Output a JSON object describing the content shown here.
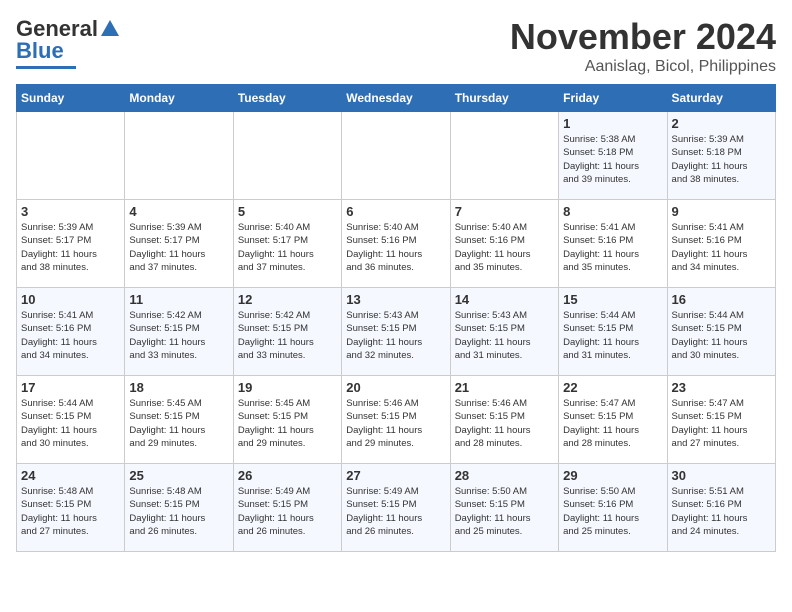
{
  "header": {
    "logo_general": "General",
    "logo_blue": "Blue",
    "month": "November 2024",
    "location": "Aanislag, Bicol, Philippines"
  },
  "days_of_week": [
    "Sunday",
    "Monday",
    "Tuesday",
    "Wednesday",
    "Thursday",
    "Friday",
    "Saturday"
  ],
  "weeks": [
    [
      {
        "day": "",
        "info": ""
      },
      {
        "day": "",
        "info": ""
      },
      {
        "day": "",
        "info": ""
      },
      {
        "day": "",
        "info": ""
      },
      {
        "day": "",
        "info": ""
      },
      {
        "day": "1",
        "info": "Sunrise: 5:38 AM\nSunset: 5:18 PM\nDaylight: 11 hours\nand 39 minutes."
      },
      {
        "day": "2",
        "info": "Sunrise: 5:39 AM\nSunset: 5:18 PM\nDaylight: 11 hours\nand 38 minutes."
      }
    ],
    [
      {
        "day": "3",
        "info": "Sunrise: 5:39 AM\nSunset: 5:17 PM\nDaylight: 11 hours\nand 38 minutes."
      },
      {
        "day": "4",
        "info": "Sunrise: 5:39 AM\nSunset: 5:17 PM\nDaylight: 11 hours\nand 37 minutes."
      },
      {
        "day": "5",
        "info": "Sunrise: 5:40 AM\nSunset: 5:17 PM\nDaylight: 11 hours\nand 37 minutes."
      },
      {
        "day": "6",
        "info": "Sunrise: 5:40 AM\nSunset: 5:16 PM\nDaylight: 11 hours\nand 36 minutes."
      },
      {
        "day": "7",
        "info": "Sunrise: 5:40 AM\nSunset: 5:16 PM\nDaylight: 11 hours\nand 35 minutes."
      },
      {
        "day": "8",
        "info": "Sunrise: 5:41 AM\nSunset: 5:16 PM\nDaylight: 11 hours\nand 35 minutes."
      },
      {
        "day": "9",
        "info": "Sunrise: 5:41 AM\nSunset: 5:16 PM\nDaylight: 11 hours\nand 34 minutes."
      }
    ],
    [
      {
        "day": "10",
        "info": "Sunrise: 5:41 AM\nSunset: 5:16 PM\nDaylight: 11 hours\nand 34 minutes."
      },
      {
        "day": "11",
        "info": "Sunrise: 5:42 AM\nSunset: 5:15 PM\nDaylight: 11 hours\nand 33 minutes."
      },
      {
        "day": "12",
        "info": "Sunrise: 5:42 AM\nSunset: 5:15 PM\nDaylight: 11 hours\nand 33 minutes."
      },
      {
        "day": "13",
        "info": "Sunrise: 5:43 AM\nSunset: 5:15 PM\nDaylight: 11 hours\nand 32 minutes."
      },
      {
        "day": "14",
        "info": "Sunrise: 5:43 AM\nSunset: 5:15 PM\nDaylight: 11 hours\nand 31 minutes."
      },
      {
        "day": "15",
        "info": "Sunrise: 5:44 AM\nSunset: 5:15 PM\nDaylight: 11 hours\nand 31 minutes."
      },
      {
        "day": "16",
        "info": "Sunrise: 5:44 AM\nSunset: 5:15 PM\nDaylight: 11 hours\nand 30 minutes."
      }
    ],
    [
      {
        "day": "17",
        "info": "Sunrise: 5:44 AM\nSunset: 5:15 PM\nDaylight: 11 hours\nand 30 minutes."
      },
      {
        "day": "18",
        "info": "Sunrise: 5:45 AM\nSunset: 5:15 PM\nDaylight: 11 hours\nand 29 minutes."
      },
      {
        "day": "19",
        "info": "Sunrise: 5:45 AM\nSunset: 5:15 PM\nDaylight: 11 hours\nand 29 minutes."
      },
      {
        "day": "20",
        "info": "Sunrise: 5:46 AM\nSunset: 5:15 PM\nDaylight: 11 hours\nand 29 minutes."
      },
      {
        "day": "21",
        "info": "Sunrise: 5:46 AM\nSunset: 5:15 PM\nDaylight: 11 hours\nand 28 minutes."
      },
      {
        "day": "22",
        "info": "Sunrise: 5:47 AM\nSunset: 5:15 PM\nDaylight: 11 hours\nand 28 minutes."
      },
      {
        "day": "23",
        "info": "Sunrise: 5:47 AM\nSunset: 5:15 PM\nDaylight: 11 hours\nand 27 minutes."
      }
    ],
    [
      {
        "day": "24",
        "info": "Sunrise: 5:48 AM\nSunset: 5:15 PM\nDaylight: 11 hours\nand 27 minutes."
      },
      {
        "day": "25",
        "info": "Sunrise: 5:48 AM\nSunset: 5:15 PM\nDaylight: 11 hours\nand 26 minutes."
      },
      {
        "day": "26",
        "info": "Sunrise: 5:49 AM\nSunset: 5:15 PM\nDaylight: 11 hours\nand 26 minutes."
      },
      {
        "day": "27",
        "info": "Sunrise: 5:49 AM\nSunset: 5:15 PM\nDaylight: 11 hours\nand 26 minutes."
      },
      {
        "day": "28",
        "info": "Sunrise: 5:50 AM\nSunset: 5:15 PM\nDaylight: 11 hours\nand 25 minutes."
      },
      {
        "day": "29",
        "info": "Sunrise: 5:50 AM\nSunset: 5:16 PM\nDaylight: 11 hours\nand 25 minutes."
      },
      {
        "day": "30",
        "info": "Sunrise: 5:51 AM\nSunset: 5:16 PM\nDaylight: 11 hours\nand 24 minutes."
      }
    ]
  ]
}
